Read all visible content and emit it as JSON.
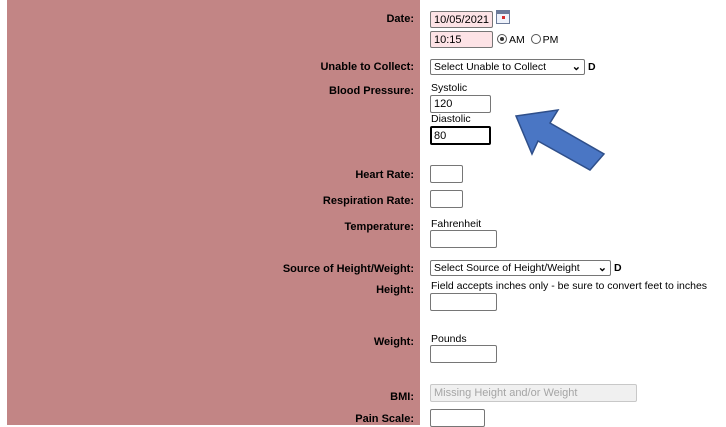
{
  "form": {
    "date": {
      "label": "Date:",
      "value": "10/05/2021"
    },
    "time": {
      "value": "10:15",
      "am_label": "AM",
      "pm_label": "PM",
      "selected": "AM"
    },
    "unable_to_collect": {
      "label": "Unable to Collect:",
      "select_value": "Select Unable to Collect",
      "suffix": "D"
    },
    "blood_pressure": {
      "label": "Blood Pressure:",
      "systolic_label": "Systolic",
      "systolic_value": "120",
      "diastolic_label": "Diastolic",
      "diastolic_value": "80"
    },
    "heart_rate": {
      "label": "Heart Rate:",
      "value": ""
    },
    "respiration_rate": {
      "label": "Respiration Rate:",
      "value": ""
    },
    "temperature": {
      "label": "Temperature:",
      "unit_label": "Fahrenheit",
      "value": ""
    },
    "source_height_weight": {
      "label": "Source of Height/Weight:",
      "select_value": "Select Source of Height/Weight",
      "suffix": "D"
    },
    "height": {
      "label": "Height:",
      "hint": "Field accepts inches only - be sure to convert feet to inches",
      "value": ""
    },
    "weight": {
      "label": "Weight:",
      "unit_label": "Pounds",
      "value": ""
    },
    "bmi": {
      "label": "BMI:",
      "value": "Missing Height and/or Weight"
    },
    "pain_scale": {
      "label": "Pain Scale:",
      "value": ""
    }
  },
  "colors": {
    "label_panel": "#c28585",
    "date_field": "#fde3e6",
    "annotation_arrow": "#4a76c4"
  },
  "icons": {
    "calendar": "calendar-icon",
    "annotation": "arrow-annotation-icon"
  }
}
